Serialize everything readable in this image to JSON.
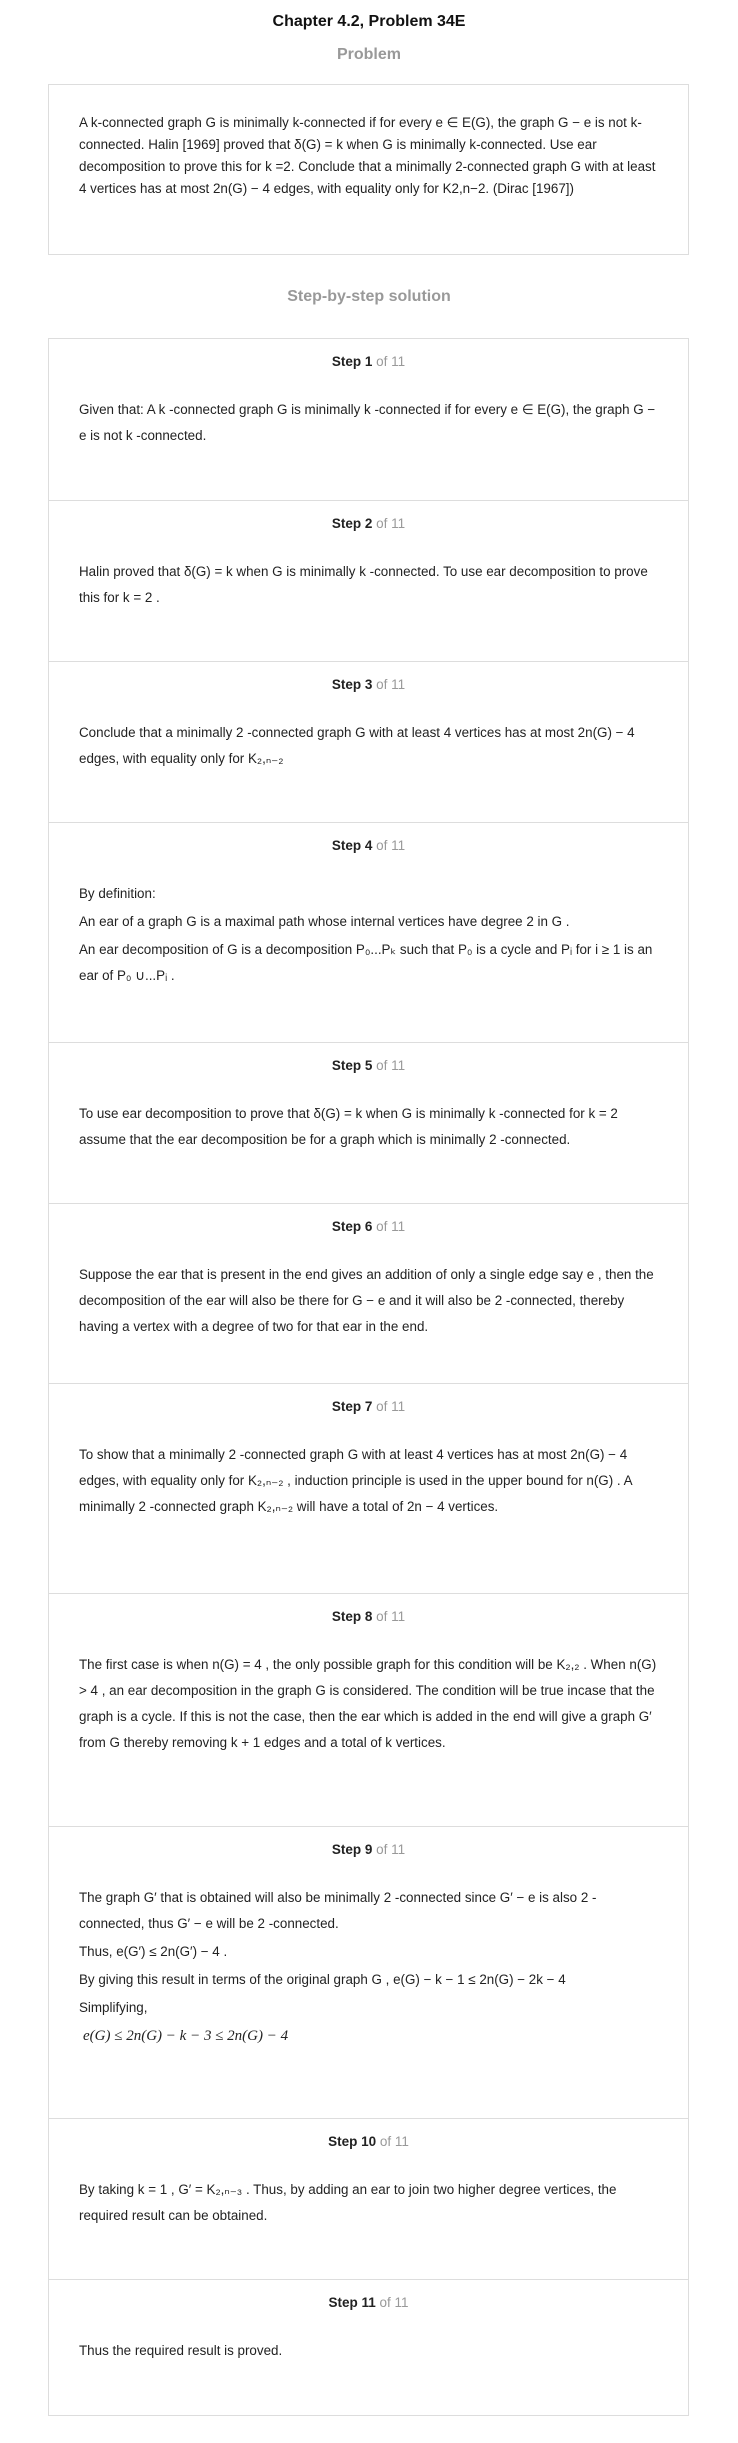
{
  "header": {
    "title": "Chapter 4.2, Problem 34E"
  },
  "problem": {
    "heading": "Problem",
    "text": "A k-connected graph G is minimally k-connected if for every e ∈ E(G), the graph G − e is not k-connected. Halin [1969] proved that δ(G) = k when G is minimally k-connected. Use ear decomposition to prove this for k =2. Conclude that a minimally 2-connected graph G with at least 4 vertices has at most 2n(G) − 4 edges, with equality only for K2,n−2. (Dirac [1967])"
  },
  "solution": {
    "heading": "Step-by-step solution",
    "of_total": "of 11",
    "steps": [
      {
        "label": "Step 1",
        "paras": [
          "Given that: A  k -connected graph  G is minimally  k -connected if for every  e ∈ E(G), the graph  G − e is not  k -connected."
        ]
      },
      {
        "label": "Step 2",
        "paras": [
          "Halin proved that  δ(G) = k when  G is minimally  k -connected. To use ear decomposition to prove this for  k = 2 ."
        ]
      },
      {
        "label": "Step 3",
        "paras": [
          "Conclude that a minimally  2 -connected graph  G with at least  4  vertices has at most  2n(G) − 4 edges, with equality only for  K₂,ₙ₋₂"
        ]
      },
      {
        "label": "Step 4",
        "paras": [
          "By definition:",
          "An ear of a graph  G  is a maximal path whose internal vertices have degree  2  in  G .",
          "An ear decomposition of  G  is a decomposition  P₀...Pₖ such that  P₀ is a cycle and  Pᵢ for  i ≥ 1 is an ear of  P₀ ∪...Pᵢ ."
        ]
      },
      {
        "label": "Step 5",
        "paras": [
          "To use ear decomposition to prove that  δ(G) = k when  G is minimally  k -connected for  k = 2  assume that the ear decomposition be for a graph which is minimally  2 -connected."
        ]
      },
      {
        "label": "Step 6",
        "paras": [
          "Suppose the ear that is present in the end gives an addition of only a single edge say  e , then the decomposition of the ear will also be there for  G − e and it will also be  2 -connected, thereby having a vertex with a degree of two for that ear in the end."
        ]
      },
      {
        "label": "Step 7",
        "paras": [
          "To show that a minimally  2 -connected graph  G with at least  4  vertices has at most  2n(G) − 4 edges, with equality only for  K₂,ₙ₋₂ , induction principle is used in the upper bound for  n(G) . A minimally  2 -connected graph  K₂,ₙ₋₂  will have a total of  2n − 4 vertices."
        ]
      },
      {
        "label": "Step 8",
        "paras": [
          "The first case is when  n(G) = 4 , the only possible graph for this condition will be  K₂,₂ . When  n(G) > 4 , an ear decomposition in the graph  G is considered. The condition will be true incase that the graph is a cycle. If this is not the case, then the ear which is added in the end will give a graph  G′  from  G thereby removing  k + 1 edges and a total of  k vertices."
        ]
      },
      {
        "label": "Step 9",
        "paras": [
          "The graph  G′ that is obtained will also be minimally  2 -connected since  G′ − e is also  2 -connected, thus  G′ − e will be  2 -connected.",
          "Thus,  e(G′) ≤ 2n(G′) − 4 .",
          "By giving this result in terms of the original graph  G ,  e(G) − k − 1 ≤ 2n(G) − 2k − 4",
          "Simplifying,",
          "e(G) ≤ 2n(G) − k − 3 ≤ 2n(G) − 4"
        ]
      },
      {
        "label": "Step 10",
        "paras": [
          "By taking  k = 1 ,  G′ = K₂,ₙ₋₃ . Thus, by adding an ear to join two higher degree vertices, the required result can be obtained."
        ]
      },
      {
        "label": "Step 11",
        "paras": [
          "Thus the required result is proved."
        ]
      }
    ]
  }
}
